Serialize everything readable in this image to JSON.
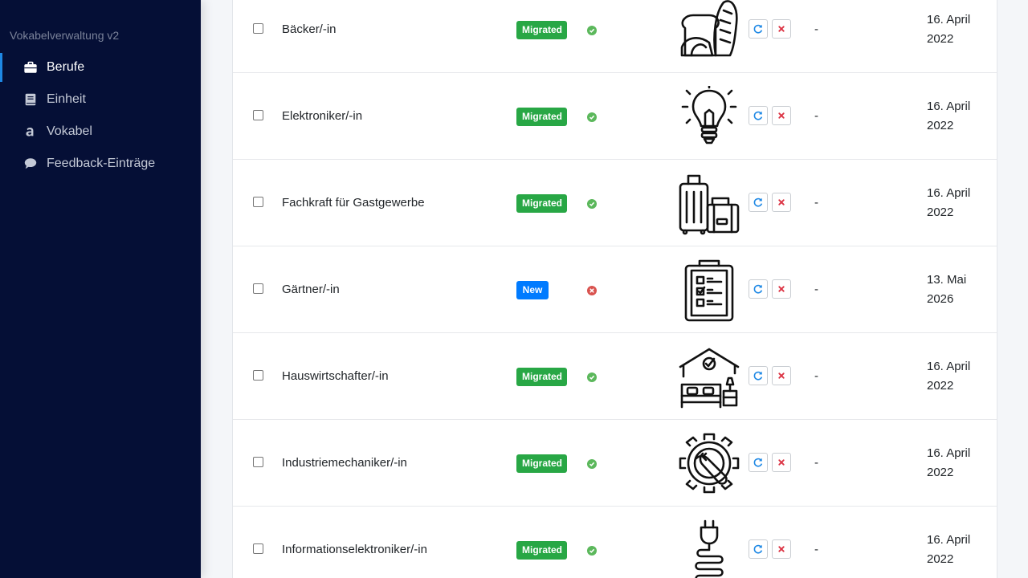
{
  "app": {
    "title": "Vokabelverwaltung v2"
  },
  "sidebar": {
    "items": [
      {
        "label": "Berufe",
        "icon": "briefcase-icon",
        "active": true
      },
      {
        "label": "Einheit",
        "icon": "book-icon",
        "active": false
      },
      {
        "label": "Vokabel",
        "icon": "letter-a-icon",
        "active": false
      },
      {
        "label": "Feedback-Einträge",
        "icon": "speech-bubble-icon",
        "active": false
      }
    ]
  },
  "table": {
    "rows": [
      {
        "name": "Bäcker/-in",
        "badge": "Migrated",
        "status": "ok",
        "image": "bread-icon",
        "extra": "-",
        "date_day": "16. April",
        "date_year": "2022"
      },
      {
        "name": "Elektroniker/-in",
        "badge": "Migrated",
        "status": "ok",
        "image": "lightbulb-icon",
        "extra": "-",
        "date_day": "16. April",
        "date_year": "2022"
      },
      {
        "name": "Fachkraft für Gastgewerbe",
        "badge": "Migrated",
        "status": "ok",
        "image": "luggage-icon",
        "extra": "-",
        "date_day": "16. April",
        "date_year": "2022"
      },
      {
        "name": "Gärtner/-in",
        "badge": "New",
        "status": "error",
        "image": "clipboard-checklist-icon",
        "extra": "-",
        "date_day": "13. Mai",
        "date_year": "2026"
      },
      {
        "name": "Hauswirtschafter/-in",
        "badge": "Migrated",
        "status": "ok",
        "image": "house-bed-icon",
        "extra": "-",
        "date_day": "16. April",
        "date_year": "2022"
      },
      {
        "name": "Industriemechaniker/-in",
        "badge": "Migrated",
        "status": "ok",
        "image": "gear-wrench-icon",
        "extra": "-",
        "date_day": "16. April",
        "date_year": "2022"
      },
      {
        "name": "Informationselektroniker/-in",
        "badge": "Migrated",
        "status": "ok",
        "image": "power-plug-cable-icon",
        "extra": "-",
        "date_day": "16. April",
        "date_year": "2022"
      }
    ]
  },
  "colors": {
    "sidebar_bg": "#050f36",
    "active_accent": "#1e88e5",
    "badge_migrated": "#28a745",
    "badge_new": "#007bff",
    "status_ok": "#5cb85c",
    "status_error": "#d9534f",
    "refresh_icon": "#1e88e5",
    "remove_icon": "#dc3545"
  }
}
